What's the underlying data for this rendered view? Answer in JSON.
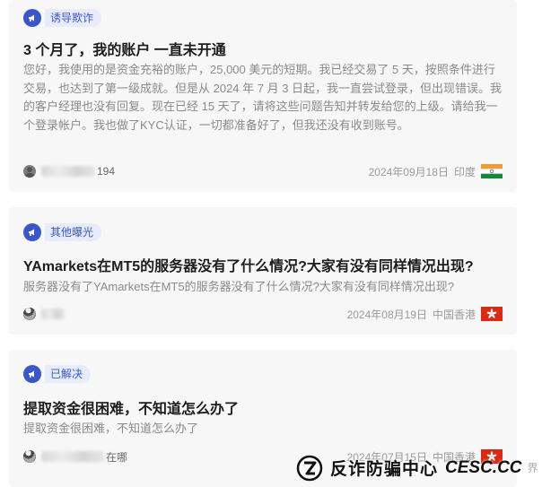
{
  "posts": [
    {
      "tag": "诱导欺诈",
      "title": "3 个月了，我的账户 一直未开通",
      "body": "您好，我使用的是资金充裕的账户，25,000 美元的短期。我已经交易了 5 天，按照条件进行交易，也达到了第一级成就。但是从 2024 年 7 月 3 日起，我一直尝试登录，但出现错误。我的客户经理也没有回复。现在已经 15 天了，请将这些问题告知并转发给您的上级。请给我一个登录帐户。我也做了KYC认证，一切都准备好了，但我还没有收到账号。",
      "author_tail": "194",
      "date": "2024年09月18日",
      "region": "印度",
      "flag_icon": "india-flag-icon"
    },
    {
      "tag": "其他曝光",
      "title": "YAmarkets在MT5的服务器没有了什么情况?大家有没有同样情况出现?",
      "body": "服务器没有了YAmarkets在MT5的服务器没有了什么情况?大家有没有同样情况出现?",
      "author_tail": "",
      "date": "2024年08月19日",
      "region": "中国香港",
      "flag_icon": "hong-kong-flag-icon"
    },
    {
      "tag": "已解决",
      "title": "提取资金很困难，不知道怎么办了",
      "body": "提取资金很困难，不知道怎么办了",
      "author_tail": "在哪",
      "date": "2024年07月15日",
      "region": "中国香港",
      "flag_icon": "hong-kong-flag-icon"
    }
  ],
  "watermark": {
    "cn": "反诈防骗中心",
    "en": "CESC.CC",
    "tail": "界"
  },
  "colors": {
    "accent": "#3a56c8",
    "tag_bg": "#e7ecfb",
    "card_bg": "#f7f7f8"
  }
}
